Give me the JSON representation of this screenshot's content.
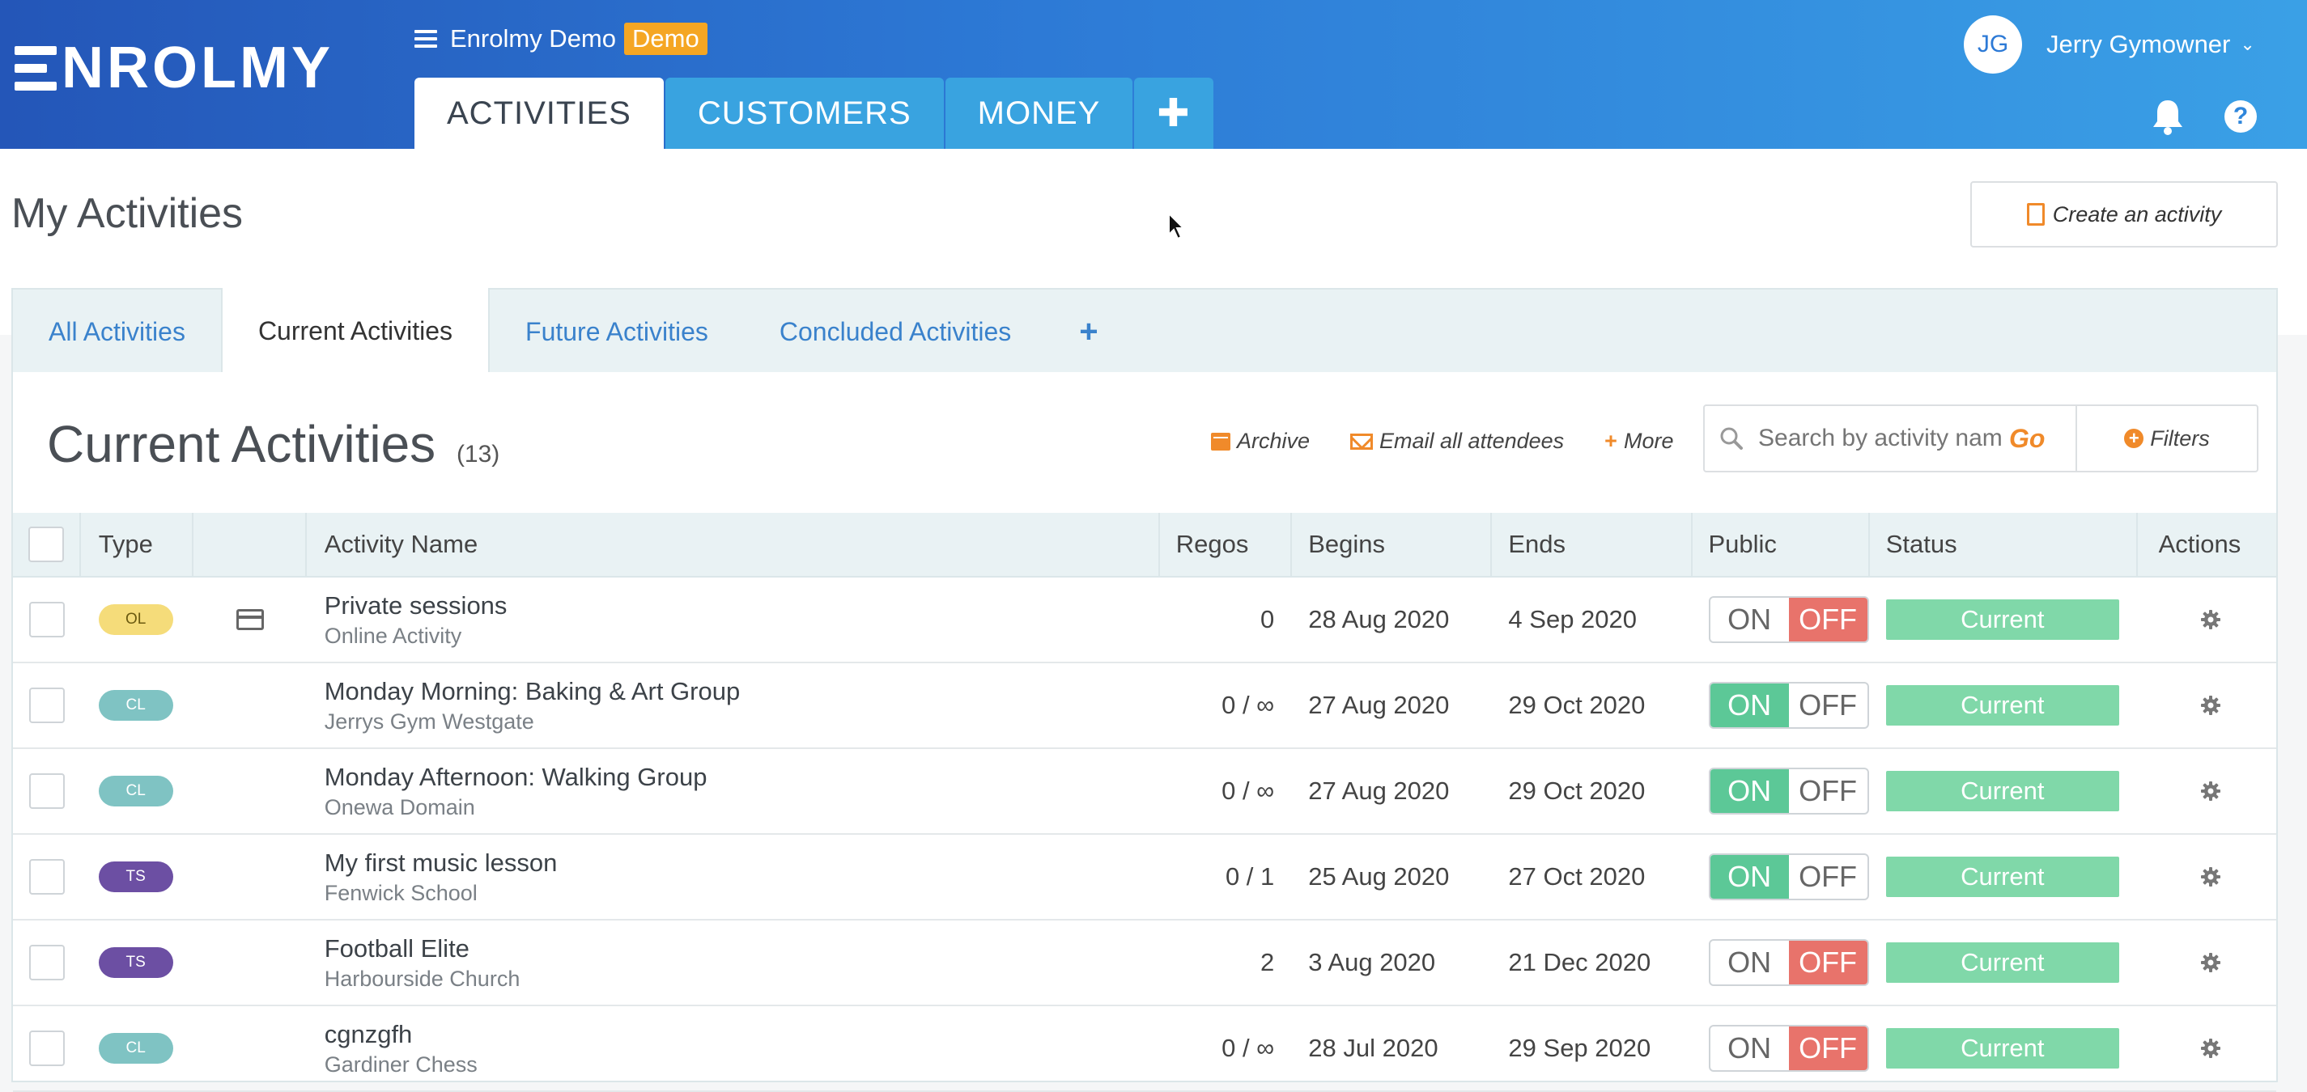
{
  "header": {
    "logo_text": "NROLMY",
    "org_name": "Enrolmy Demo",
    "demo_badge": "Demo",
    "main_tabs": [
      {
        "label": "ACTIVITIES"
      },
      {
        "label": "CUSTOMERS"
      },
      {
        "label": "MONEY"
      },
      {
        "label": "✚"
      }
    ],
    "user": {
      "initials": "JG",
      "name": "Jerry Gymowner"
    },
    "help_label": "?"
  },
  "page": {
    "title": "My Activities",
    "create_button": "Create an activity"
  },
  "subtabs": [
    {
      "label": "All Activities"
    },
    {
      "label": "Current Activities"
    },
    {
      "label": "Future Activities"
    },
    {
      "label": "Concluded Activities"
    },
    {
      "label": "+"
    }
  ],
  "panel": {
    "title": "Current Activities",
    "count": "(13)",
    "toolbar": {
      "archive": "Archive",
      "email": "Email all attendees",
      "more": "More"
    },
    "search": {
      "placeholder": "Search by activity name",
      "go": "Go",
      "filters": "Filters"
    }
  },
  "table": {
    "headers": {
      "type": "Type",
      "name": "Activity Name",
      "regos": "Regos",
      "begins": "Begins",
      "ends": "Ends",
      "public": "Public",
      "status": "Status",
      "actions": "Actions"
    },
    "toggle_on": "ON",
    "toggle_off": "OFF",
    "rows": [
      {
        "type": "OL",
        "type_bg": "#f5dc7a",
        "type_fg": "#6b5a10",
        "card": true,
        "name": "Private sessions",
        "venue": "Online Activity",
        "regos": "0",
        "begins": "28 Aug 2020",
        "ends": "4 Sep 2020",
        "public": false,
        "status": "Current"
      },
      {
        "type": "CL",
        "type_bg": "#7fc3c3",
        "type_fg": "#ffffff",
        "card": false,
        "name": "Monday Morning: Baking & Art Group",
        "venue": "Jerrys Gym Westgate",
        "regos": "0 / ∞",
        "begins": "27 Aug 2020",
        "ends": "29 Oct 2020",
        "public": true,
        "status": "Current"
      },
      {
        "type": "CL",
        "type_bg": "#7fc3c3",
        "type_fg": "#ffffff",
        "card": false,
        "name": "Monday Afternoon: Walking Group",
        "venue": "Onewa Domain",
        "regos": "0 / ∞",
        "begins": "27 Aug 2020",
        "ends": "29 Oct 2020",
        "public": true,
        "status": "Current"
      },
      {
        "type": "TS",
        "type_bg": "#6c4fa3",
        "type_fg": "#ffffff",
        "card": false,
        "name": "My first music lesson",
        "venue": "Fenwick School",
        "regos": "0 / 1",
        "begins": "25 Aug 2020",
        "ends": "27 Oct 2020",
        "public": true,
        "status": "Current"
      },
      {
        "type": "TS",
        "type_bg": "#6c4fa3",
        "type_fg": "#ffffff",
        "card": false,
        "name": "Football Elite",
        "venue": "Harbourside Church",
        "regos": "2",
        "begins": "3 Aug 2020",
        "ends": "21 Dec 2020",
        "public": false,
        "status": "Current"
      },
      {
        "type": "CL",
        "type_bg": "#7fc3c3",
        "type_fg": "#ffffff",
        "card": false,
        "name": "cgnzgfh",
        "venue": "Gardiner Chess",
        "regos": "0 / ∞",
        "begins": "28 Jul 2020",
        "ends": "29 Sep 2020",
        "public": false,
        "status": "Current"
      }
    ]
  }
}
